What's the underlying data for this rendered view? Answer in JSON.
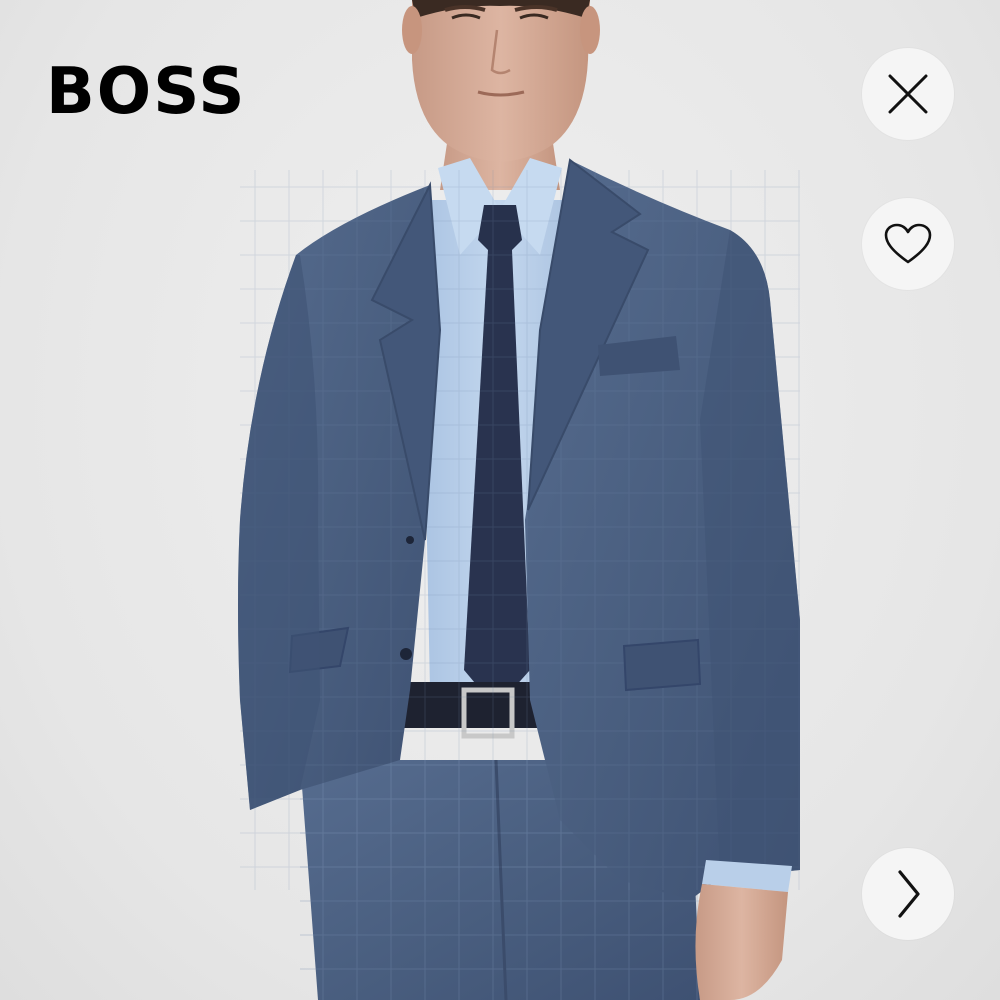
{
  "header": {
    "brand_logo_text": "BOSS"
  },
  "actions": {
    "close_icon": "close-icon",
    "favorite_icon": "heart-outline-icon",
    "next_icon": "chevron-right-icon"
  },
  "product_image": {
    "subject": "model-wearing-blue-suit",
    "colors": {
      "background": "#e9e9e9",
      "suit": "#4a5f80",
      "shirt": "#b9cfe9",
      "tie": "#29334f",
      "belt": "#1e2230"
    }
  }
}
